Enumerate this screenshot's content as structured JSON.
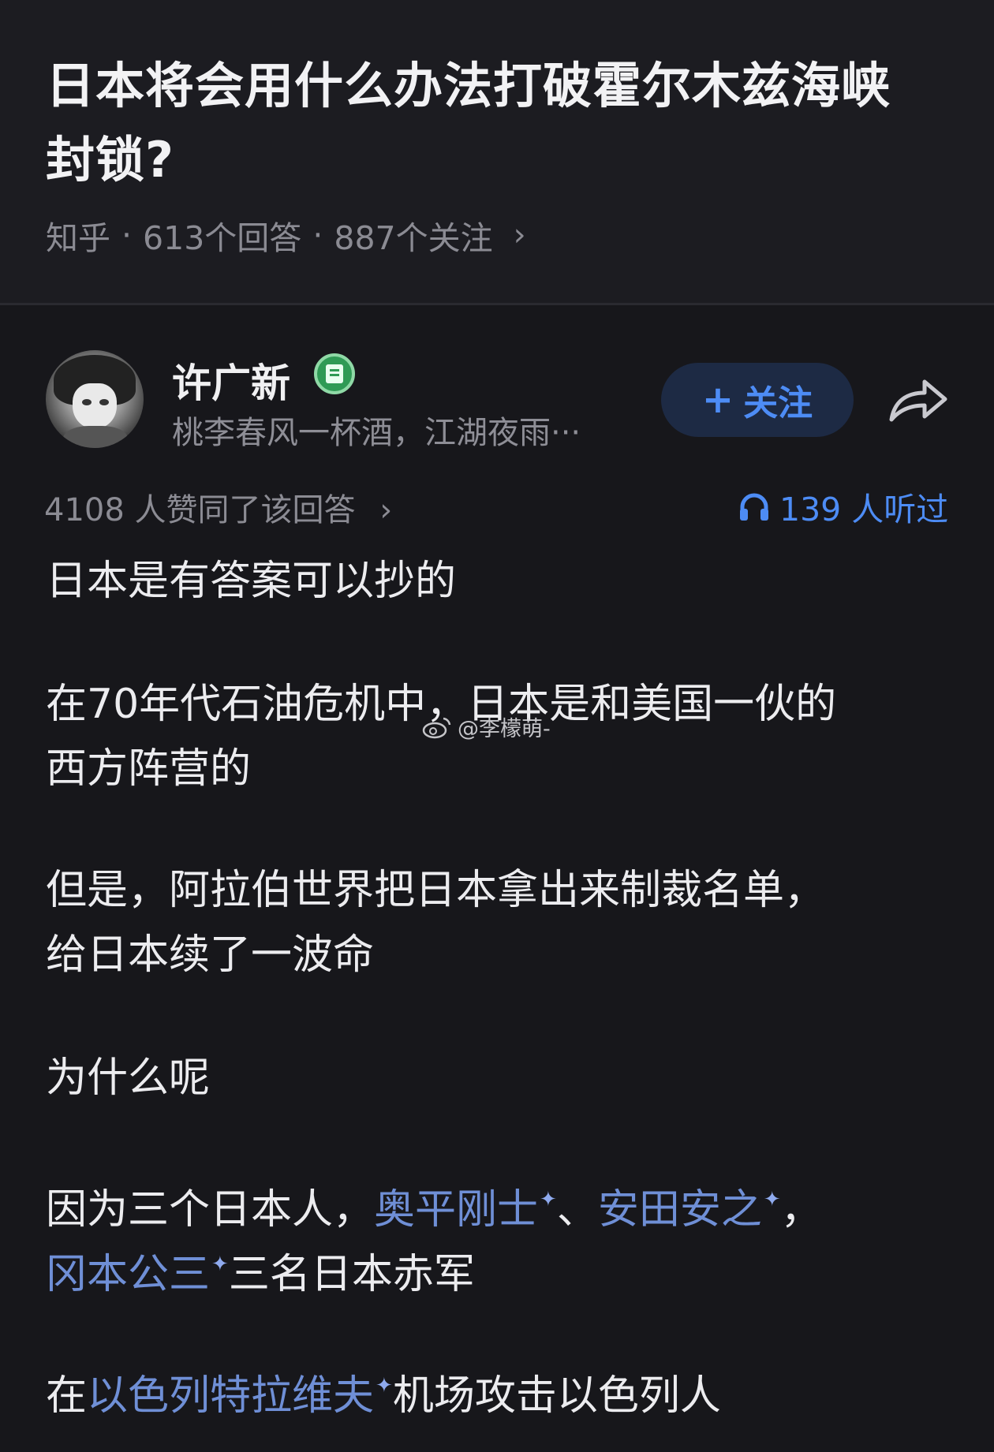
{
  "question": {
    "title_line1": "日本将会用什么办法打破霍尔木兹海峡",
    "title_line2": "封锁?",
    "source": "知乎",
    "answers": "613个回答",
    "followers": "887个关注",
    "chevron": "›"
  },
  "author": {
    "name": "许广新",
    "bio": "桃李春风一杯酒，江湖夜雨···",
    "follow_label": "关注",
    "follow_plus": "+"
  },
  "stats": {
    "approve_text": "4108 人赞同了该回答",
    "approve_chevron": "›",
    "listen_text": "139 人听过"
  },
  "answer": {
    "p1": "日本是有答案可以抄的",
    "p2_line1": "在70年代石油危机中，日本是和美国一伙的",
    "p2_line2": "西方阵营的",
    "p3_line1": "但是，阿拉伯世界把日本拿出来制裁名单，",
    "p3_line2": "给日本续了一波命",
    "p4": "为什么呢",
    "p5_a": "因为三个日本人，",
    "p5_link1": "奥平刚士",
    "p5_sep": "、",
    "p5_link2": "安田安之",
    "p5_comma": "，",
    "p5_link3": "冈本公三",
    "p5_b": "三名日本赤军",
    "p6_a": "在",
    "p6_link": "以色列特拉维夫",
    "p6_b": "机场攻击以色列人",
    "sparkle": "✦"
  },
  "watermark": "@李檬萌-",
  "colors": {
    "background": "#17171b",
    "header_bg": "#1c1c21",
    "accent_blue": "#4d8cf5",
    "link_blue": "#6f8fd6",
    "badge_green": "#2f9a55"
  }
}
